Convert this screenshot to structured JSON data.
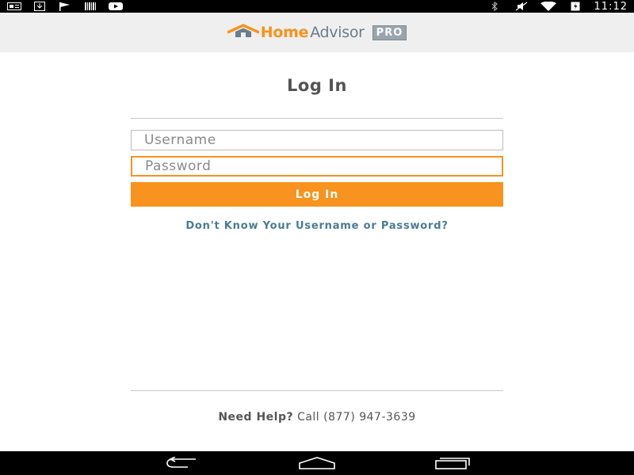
{
  "status_bar": {
    "left_icons": [
      "news-icon",
      "download-icon",
      "flag-icon",
      "barcode-icon",
      "youtube-icon"
    ],
    "right_icons": [
      "bluetooth-icon",
      "mute-icon",
      "wifi-icon",
      "battery-icon"
    ],
    "time": "11:12"
  },
  "header": {
    "logo_home": "Home",
    "logo_advisor": "Advisor",
    "logo_pro": "PRO"
  },
  "login": {
    "title": "Log In",
    "username_placeholder": "Username",
    "password_placeholder": "Password",
    "button_label": "Log In",
    "forgot_link": "Don't Know Your Username or Password?"
  },
  "footer": {
    "help_label": "Need Help?",
    "help_text": "Call (877) 947-3639"
  },
  "nav_bar": {
    "icons": [
      "back-icon",
      "home-icon",
      "recents-icon"
    ]
  },
  "colors": {
    "accent": "#f7931e",
    "link": "#4a7a96",
    "header_bg": "#efefef"
  }
}
